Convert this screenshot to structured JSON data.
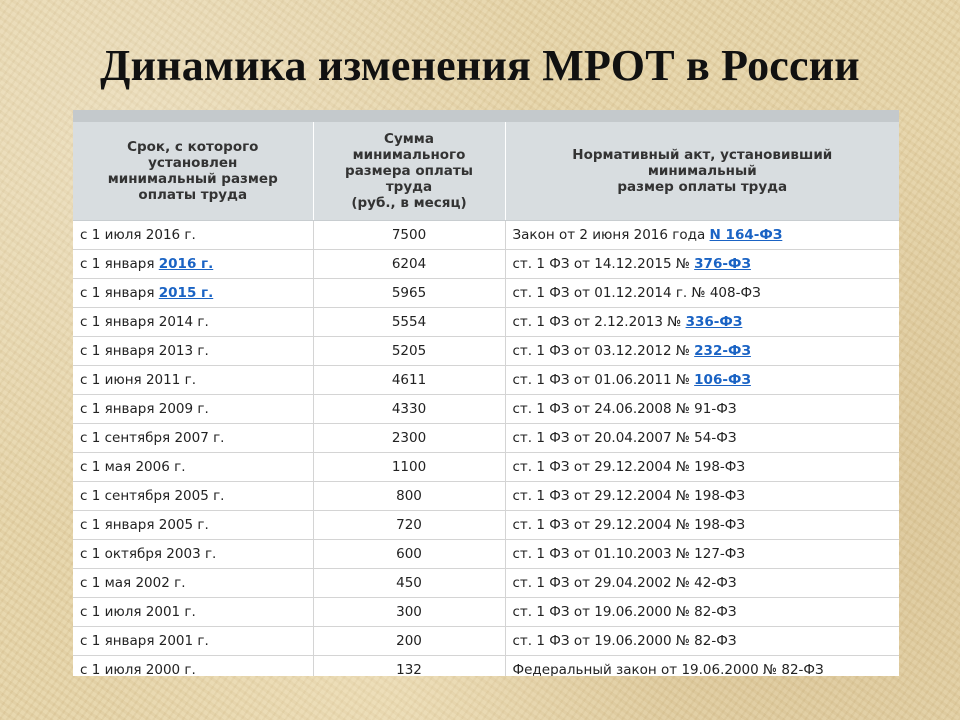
{
  "title": "Динамика изменения МРОТ в России",
  "table": {
    "headers": [
      [
        "Срок, с которого",
        "установлен",
        "минимальный размер",
        "оплаты труда"
      ],
      [
        "Сумма",
        "минимального",
        "размера оплаты",
        "труда",
        "(руб., в месяц)"
      ],
      [
        "Нормативный акт, установивший",
        "минимальный",
        "размер оплаты труда"
      ]
    ],
    "rows": [
      {
        "date": "с 1 июля 2016 г.",
        "date_link": "",
        "sum": "7500",
        "act": "Закон от 2 июня 2016 года",
        "act_link": "N 164-ФЗ"
      },
      {
        "date": "с 1 января",
        "date_link": "2016 г.",
        "sum": "6204",
        "act": "ст. 1 ФЗ от 14.12.2015 №",
        "act_link": "376-ФЗ"
      },
      {
        "date": "с 1 января",
        "date_link": "2015 г.",
        "sum": "5965",
        "act": "ст. 1 ФЗ от 01.12.2014 г. № 408-ФЗ",
        "act_link": ""
      },
      {
        "date": "с 1 января 2014 г.",
        "date_link": "",
        "sum": "5554",
        "act": "ст. 1 ФЗ от 2.12.2013 №",
        "act_link": "336-ФЗ"
      },
      {
        "date": "с 1 января 2013 г.",
        "date_link": "",
        "sum": "5205",
        "act": "ст. 1 ФЗ от 03.12.2012 №",
        "act_link": "232-ФЗ"
      },
      {
        "date": "с 1 июня 2011 г.",
        "date_link": "",
        "sum": "4611",
        "act": "ст. 1 ФЗ от 01.06.2011 №",
        "act_link": "106-ФЗ"
      },
      {
        "date": "с 1 января 2009 г.",
        "date_link": "",
        "sum": "4330",
        "act": "ст. 1 ФЗ от 24.06.2008 № 91-ФЗ",
        "act_link": ""
      },
      {
        "date": "с 1 сентября 2007 г.",
        "date_link": "",
        "sum": "2300",
        "act": "ст. 1 ФЗ от 20.04.2007 № 54-ФЗ",
        "act_link": ""
      },
      {
        "date": "с 1 мая 2006 г.",
        "date_link": "",
        "sum": "1100",
        "act": "ст. 1 ФЗ от 29.12.2004 № 198-ФЗ",
        "act_link": ""
      },
      {
        "date": "с 1 сентября 2005 г.",
        "date_link": "",
        "sum": "800",
        "act": "ст. 1 ФЗ от 29.12.2004 № 198-ФЗ",
        "act_link": ""
      },
      {
        "date": "с 1 января 2005 г.",
        "date_link": "",
        "sum": "720",
        "act": "ст. 1 ФЗ от 29.12.2004 № 198-ФЗ",
        "act_link": ""
      },
      {
        "date": "с 1 октября 2003 г.",
        "date_link": "",
        "sum": "600",
        "act": "ст. 1 ФЗ от 01.10.2003 № 127-ФЗ",
        "act_link": ""
      },
      {
        "date": "с 1 мая 2002 г.",
        "date_link": "",
        "sum": "450",
        "act": "ст. 1 ФЗ от 29.04.2002 № 42-ФЗ",
        "act_link": ""
      },
      {
        "date": "с 1 июля 2001 г.",
        "date_link": "",
        "sum": "300",
        "act": "ст. 1 ФЗ от 19.06.2000 № 82-ФЗ",
        "act_link": ""
      },
      {
        "date": "с 1 января 2001 г.",
        "date_link": "",
        "sum": "200",
        "act": "ст. 1 ФЗ от 19.06.2000 № 82-ФЗ",
        "act_link": ""
      },
      {
        "date": "с 1 июля 2000 г.",
        "date_link": "",
        "sum": "132",
        "act": "Федеральный закон от 19.06.2000 № 82-ФЗ",
        "act_link": ""
      }
    ]
  }
}
